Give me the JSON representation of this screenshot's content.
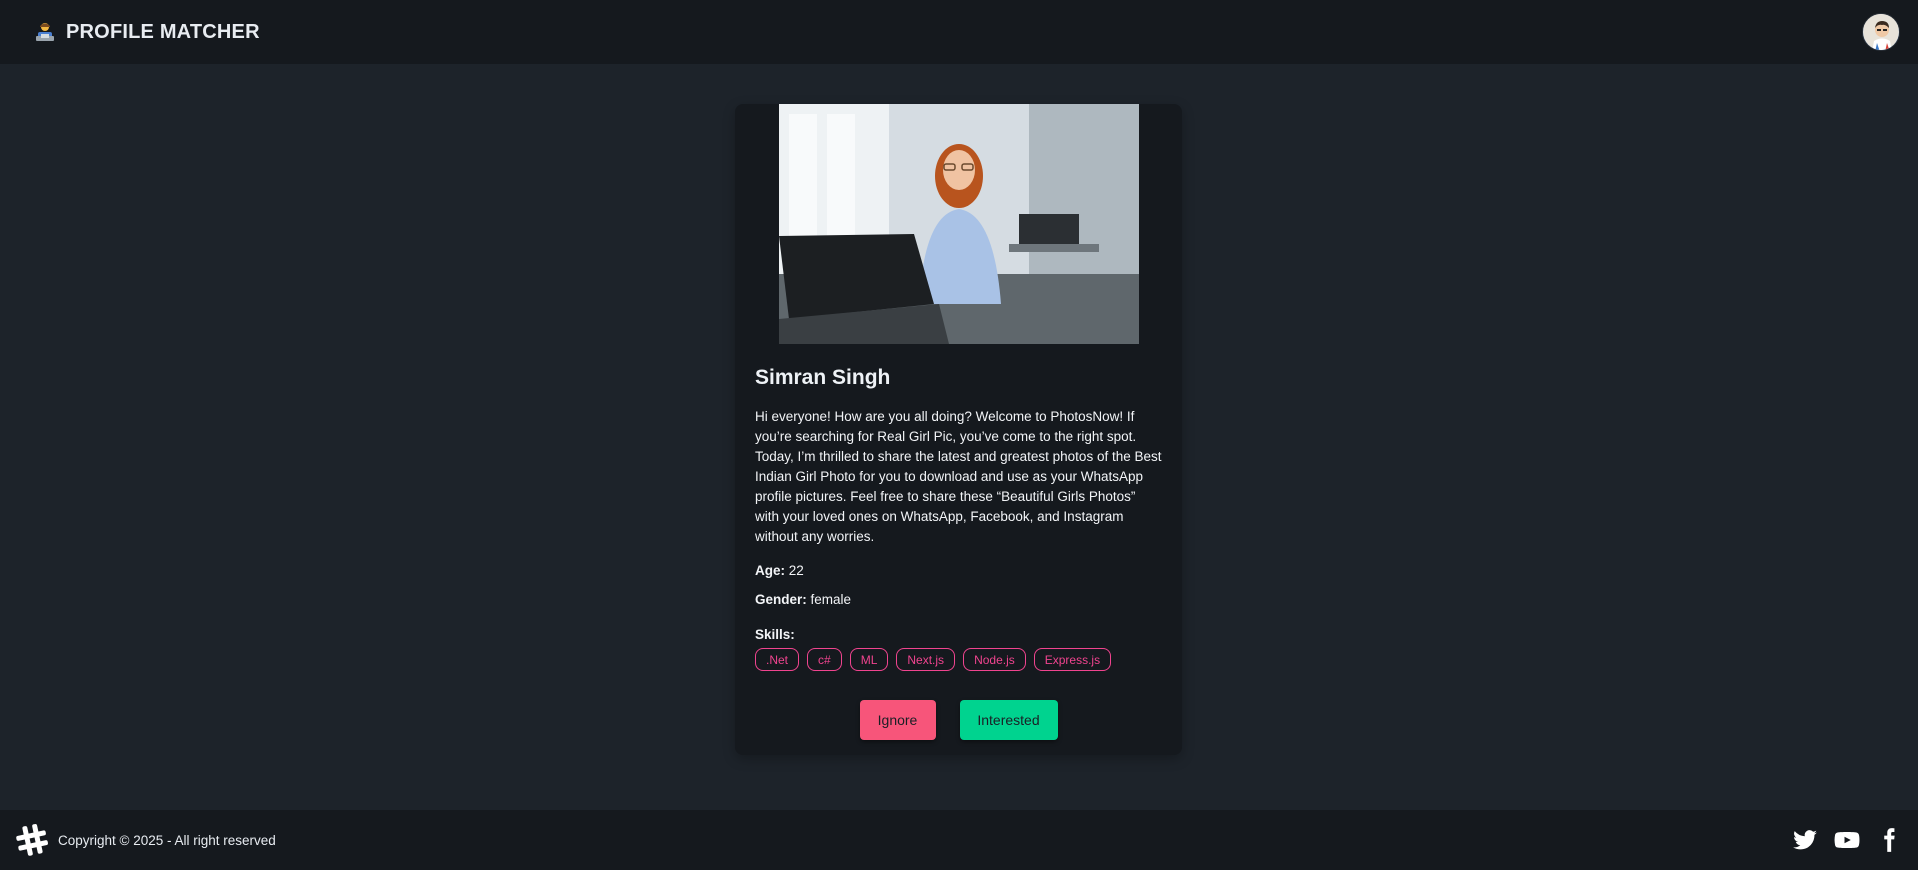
{
  "header": {
    "brand_icon": "technologist-emoji-icon",
    "title": "PROFILE MATCHER",
    "avatar": "user-avatar"
  },
  "profile": {
    "photo": "profile-photo",
    "name": "Simran Singh",
    "bio": "Hi everyone! How are you all doing? Welcome to PhotosNow! If you’re searching for Real Girl Pic, you’ve come to the right spot. Today, I’m thrilled to share the latest and greatest photos of the Best Indian Girl Photo for you to download and use as your WhatsApp profile pictures. Feel free to share these “Beautiful Girls Photos” with your loved ones on WhatsApp, Facebook, and Instagram without any worries.",
    "age_label": "Age:",
    "age": "22",
    "gender_label": "Gender:",
    "gender": "female",
    "skills_label": "Skills:",
    "skills": [
      ".Net",
      "c#",
      "ML",
      "Next.js",
      "Node.js",
      "Express.js"
    ]
  },
  "actions": {
    "ignore_label": "Ignore",
    "interested_label": "Interested"
  },
  "footer": {
    "logo_icon": "hash-icon",
    "copyright": "Copyright © 2025 - All right reserved",
    "socials": [
      "twitter-icon",
      "youtube-icon",
      "facebook-icon"
    ]
  },
  "colors": {
    "page_bg": "#1d232a",
    "bar_bg": "#15191e",
    "card_bg": "#15191e",
    "skill_accent": "#f0448f",
    "ignore_button": "#f7557a",
    "interested_button": "#00d38f"
  }
}
